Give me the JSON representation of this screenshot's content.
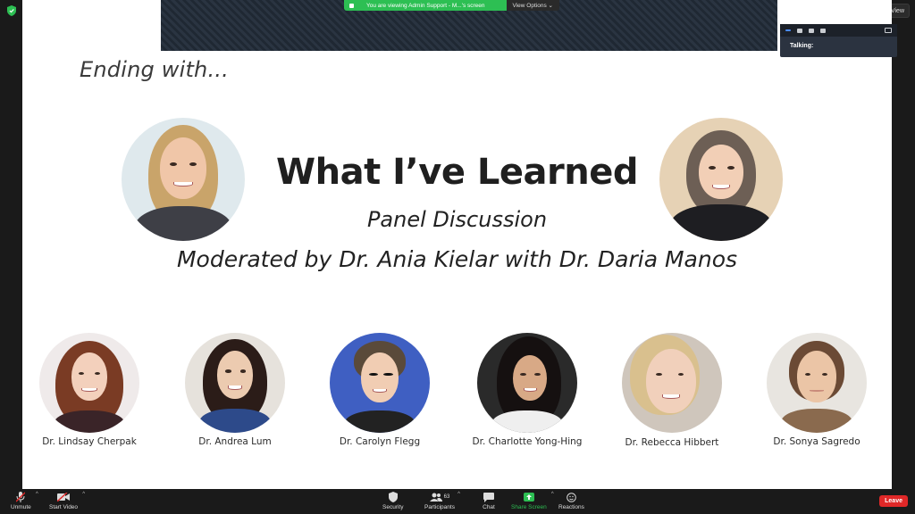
{
  "top": {
    "view_label": "View"
  },
  "banner": {
    "message": "You are viewing Admin Support - M...'s screen",
    "options_label": "View Options ⌄"
  },
  "talking": {
    "label": "Talking:"
  },
  "slide": {
    "ending_text": "Ending with...",
    "title": "What I’ve Learned",
    "subtitle": "Panel Discussion",
    "moderated": "Moderated by Dr. Ania Kielar with Dr. Daria Manos",
    "panelists": [
      "Dr. Lindsay Cherpak",
      "Dr. Andrea Lum",
      "Dr. Carolyn Flegg",
      "Dr. Charlotte Yong-Hing",
      "Dr. Rebecca Hibbert",
      "Dr. Sonya Sagredo"
    ]
  },
  "toolbar": {
    "unmute": "Unmute",
    "start_video": "Start Video",
    "security": "Security",
    "participants": "Participants",
    "participants_count": "63",
    "chat": "Chat",
    "share_screen": "Share Screen",
    "reactions": "Reactions",
    "leave": "Leave"
  },
  "colors": {
    "share_green": "#2dbf53",
    "leave_red": "#e02828",
    "talking_blue": "#4a8cff"
  }
}
